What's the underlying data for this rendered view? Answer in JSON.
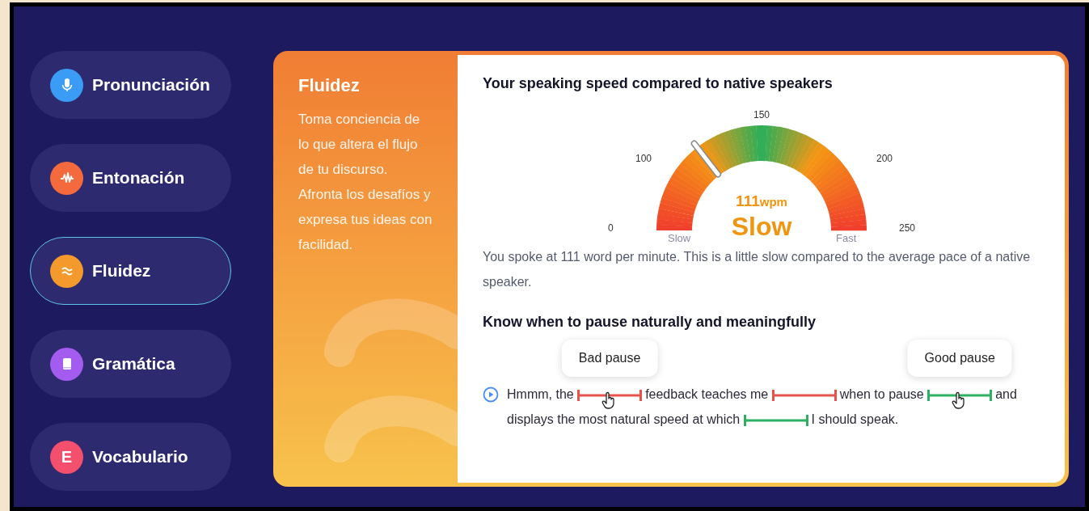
{
  "sidebar": {
    "items": [
      {
        "label": "Pronunciación",
        "kind": "mic",
        "color": "#3b9cf5",
        "selected": false
      },
      {
        "label": "Entonación",
        "kind": "wave",
        "color": "#f46a3c",
        "selected": false
      },
      {
        "label": "Fluidez",
        "kind": "approx",
        "color": "#f49a2c",
        "selected": true
      },
      {
        "label": "Gramática",
        "kind": "book",
        "color": "#a45cf0",
        "selected": false
      },
      {
        "label": "Vocabulario",
        "kind": "letter",
        "glyph": "E",
        "color": "#f4506e",
        "selected": false
      }
    ]
  },
  "intro": {
    "title": "Fluidez",
    "text": "Toma conciencia de lo que altera el flujo de tu discurso. Afronta los desafíos y expresa tus ideas con facilidad."
  },
  "speed": {
    "heading": "Your speaking speed compared to native speakers",
    "gauge": {
      "ticks": [
        "0",
        "100",
        "150",
        "200",
        "250"
      ],
      "level": 0.29,
      "reading": "111",
      "unit": "wpm",
      "verdict": "Slow",
      "low_label": "Slow",
      "high_label": "Fast"
    },
    "summary": "You spoke at 111 word per minute. This is a little slow compared to the average pace of a native speaker."
  },
  "pauses": {
    "heading": "Know when to pause naturally and meaningfully",
    "segments": [
      {
        "kind": "text",
        "text": "Hmmm, the"
      },
      {
        "kind": "bad",
        "callout": "Bad pause",
        "pointer": true
      },
      {
        "kind": "text",
        "text": "feedback teaches me"
      },
      {
        "kind": "bad"
      },
      {
        "kind": "text",
        "text": "when to pause"
      },
      {
        "kind": "good",
        "callout": "Good pause",
        "pointer": true
      },
      {
        "kind": "text",
        "text": "and"
      },
      {
        "kind": "text",
        "text": "displays the most natural speed at which"
      },
      {
        "kind": "good"
      },
      {
        "kind": "text",
        "text": "I should speak."
      }
    ]
  }
}
